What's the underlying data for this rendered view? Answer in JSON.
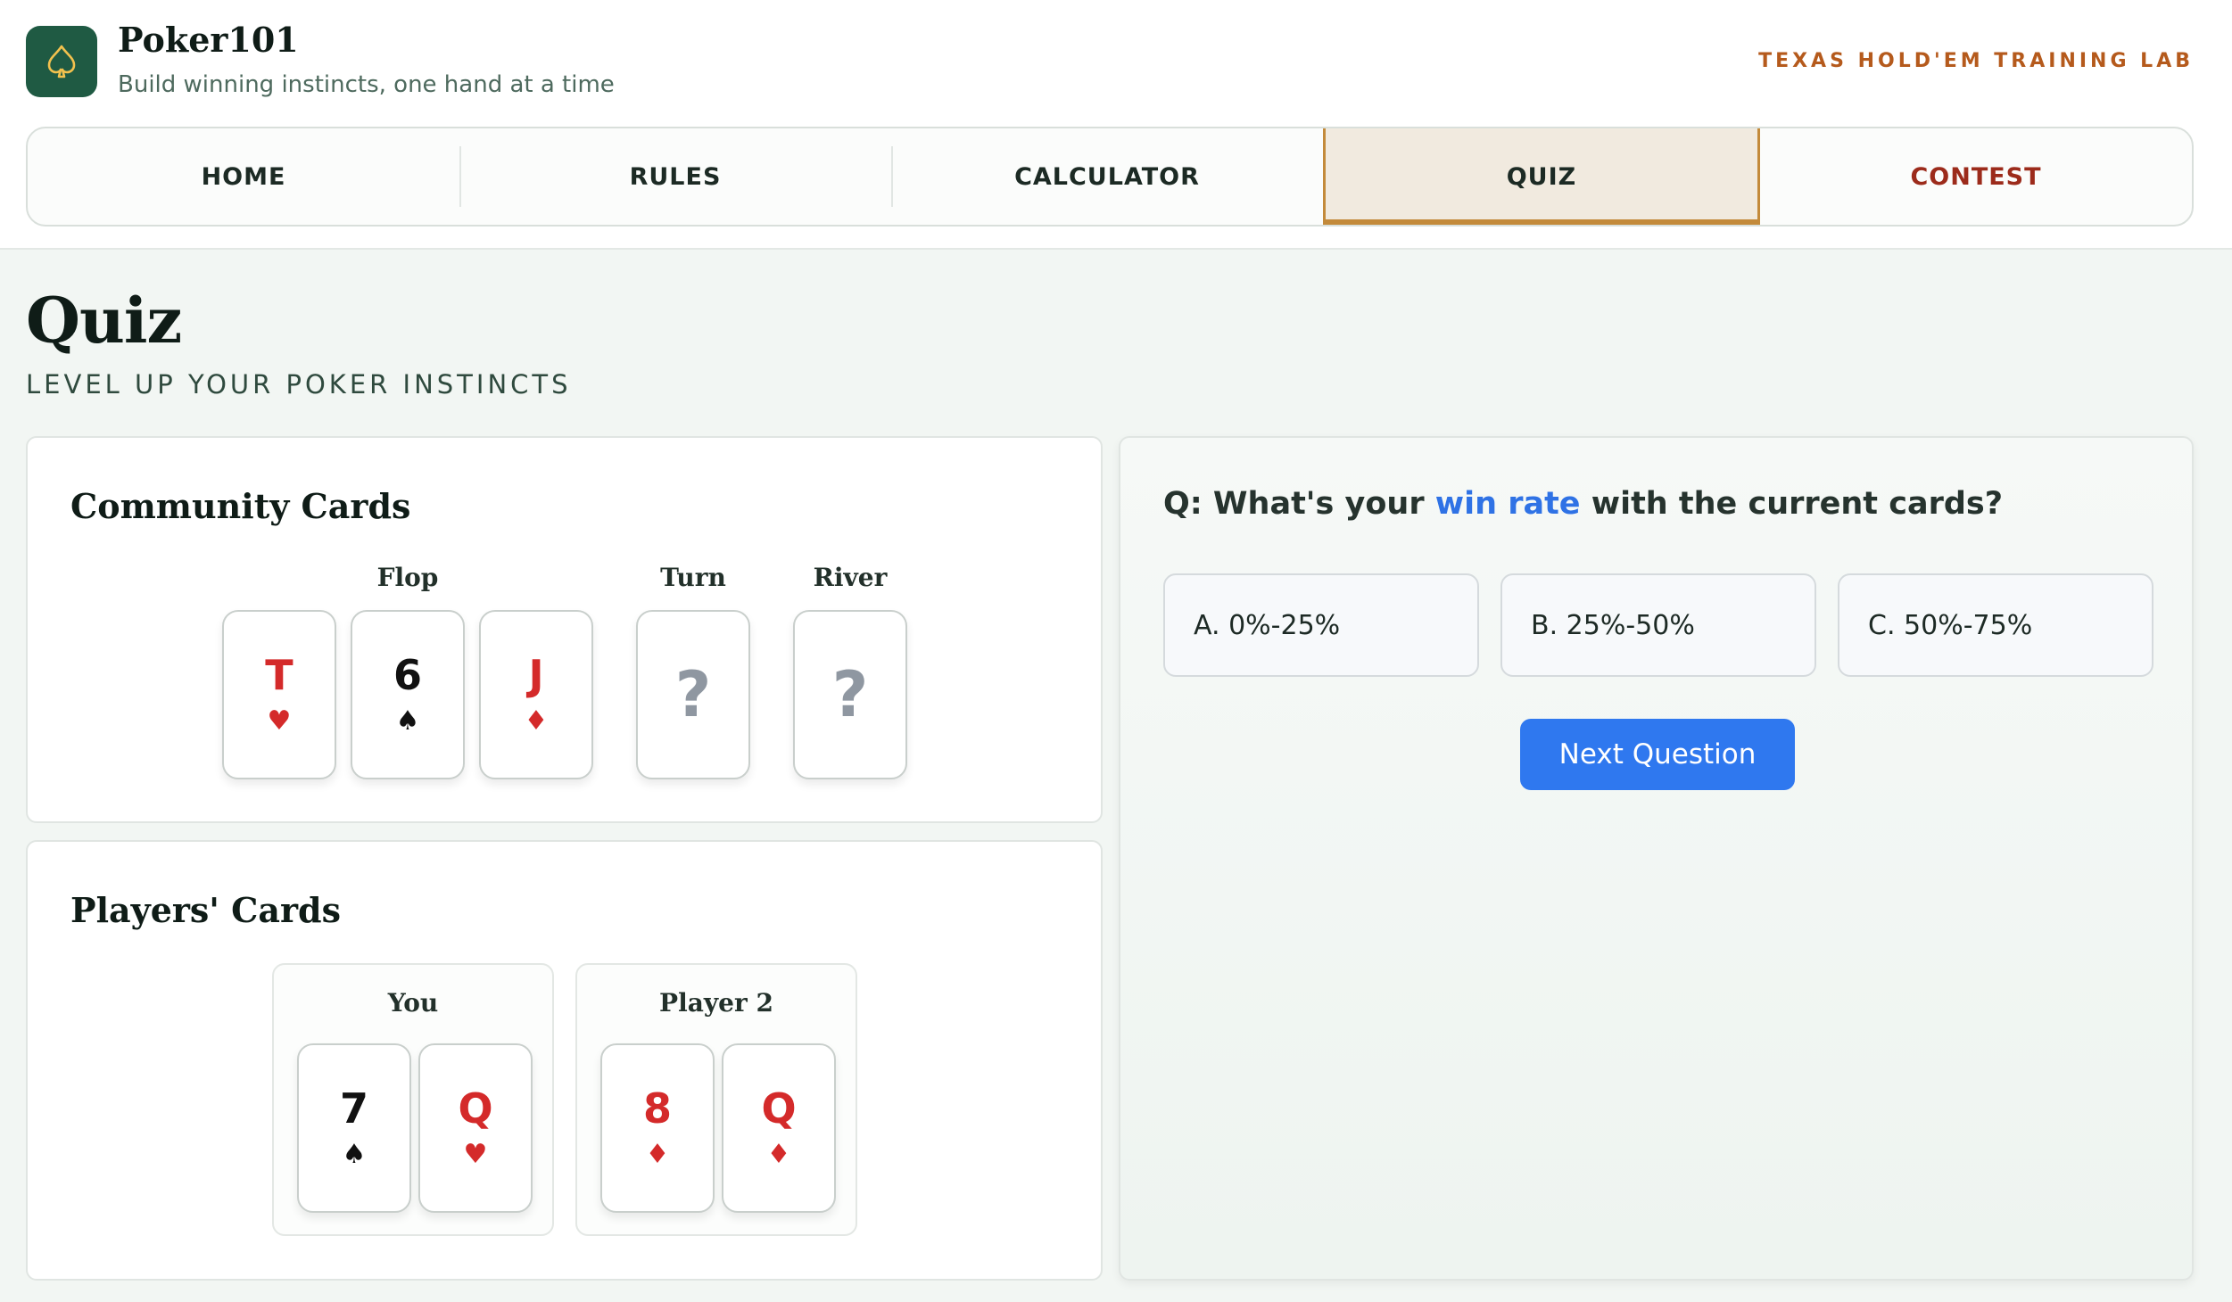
{
  "header": {
    "brand_name": "Poker101",
    "tagline": "Build winning instincts, one hand at a time",
    "lab_label": "TEXAS HOLD'EM TRAINING LAB",
    "logo_icon": "spade-icon",
    "logo_color": "#1f5a43"
  },
  "nav": {
    "tabs": [
      {
        "label": "HOME"
      },
      {
        "label": "RULES"
      },
      {
        "label": "CALCULATOR"
      },
      {
        "label": "QUIZ",
        "active": true
      },
      {
        "label": "CONTEST"
      }
    ]
  },
  "page": {
    "title": "Quiz",
    "subtitle": "LEVEL UP YOUR POKER INSTINCTS"
  },
  "community": {
    "title": "Community Cards",
    "labels": {
      "flop": "Flop",
      "turn": "Turn",
      "river": "River"
    },
    "flop": [
      {
        "rank": "T",
        "suit": "♥",
        "color": "red"
      },
      {
        "rank": "6",
        "suit": "♠",
        "color": "black"
      },
      {
        "rank": "J",
        "suit": "♦",
        "color": "red"
      }
    ],
    "turn": {
      "hidden": "?"
    },
    "river": {
      "hidden": "?"
    }
  },
  "players": {
    "title": "Players' Cards",
    "list": [
      {
        "name": "You",
        "cards": [
          {
            "rank": "7",
            "suit": "♠",
            "color": "black"
          },
          {
            "rank": "Q",
            "suit": "♥",
            "color": "red"
          }
        ]
      },
      {
        "name": "Player 2",
        "cards": [
          {
            "rank": "8",
            "suit": "♦",
            "color": "red"
          },
          {
            "rank": "Q",
            "suit": "♦",
            "color": "red"
          }
        ]
      }
    ]
  },
  "quiz": {
    "question_prefix": "Q: What's your ",
    "question_highlight": "win rate",
    "question_suffix": " with the current cards?",
    "options": [
      {
        "label": "A. 0%-25%"
      },
      {
        "label": "B. 25%-50%"
      },
      {
        "label": "C. 50%-75%"
      }
    ],
    "next_label": "Next Question",
    "accent_color": "#2f78ef"
  }
}
